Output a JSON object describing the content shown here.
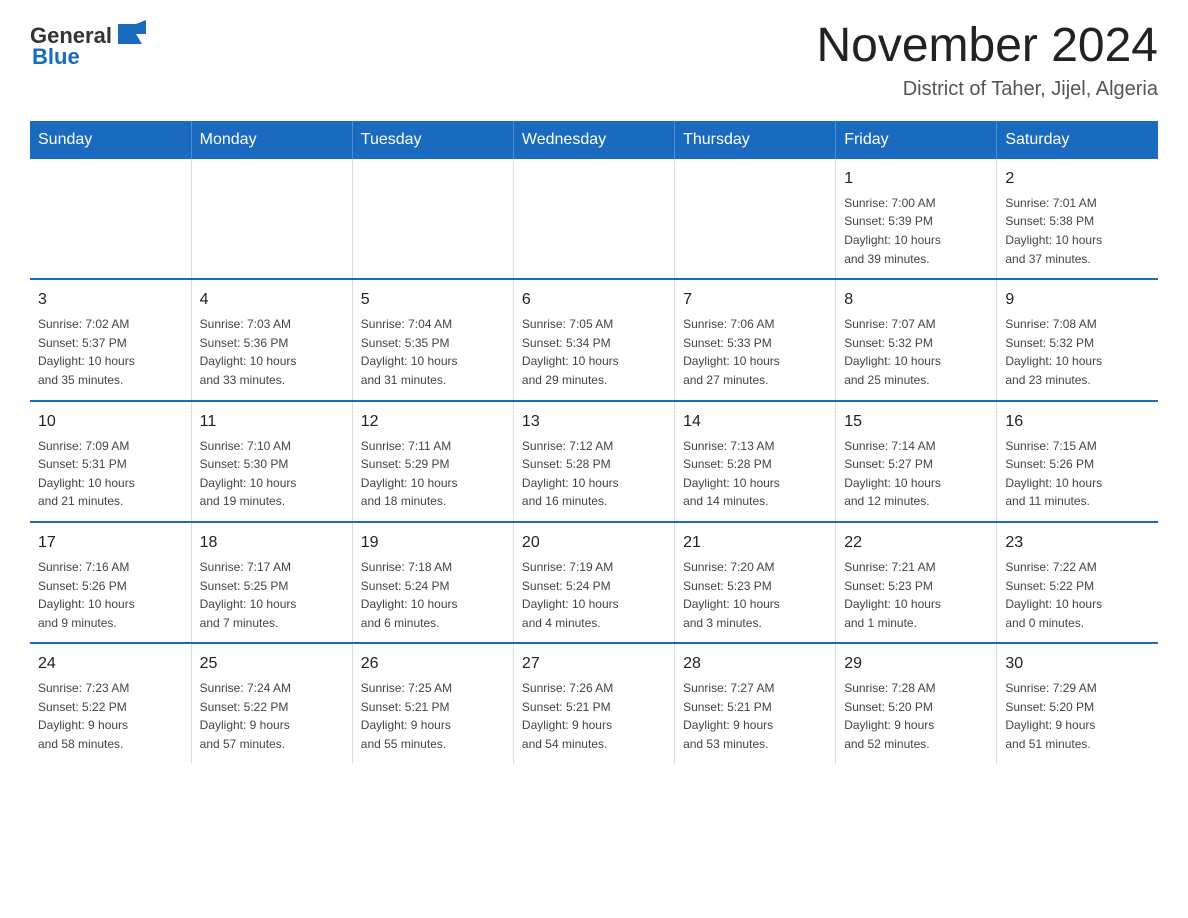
{
  "header": {
    "logo_general": "General",
    "logo_blue": "Blue",
    "month_title": "November 2024",
    "location": "District of Taher, Jijel, Algeria"
  },
  "weekdays": [
    "Sunday",
    "Monday",
    "Tuesday",
    "Wednesday",
    "Thursday",
    "Friday",
    "Saturday"
  ],
  "weeks": [
    [
      {
        "day": "",
        "info": ""
      },
      {
        "day": "",
        "info": ""
      },
      {
        "day": "",
        "info": ""
      },
      {
        "day": "",
        "info": ""
      },
      {
        "day": "",
        "info": ""
      },
      {
        "day": "1",
        "info": "Sunrise: 7:00 AM\nSunset: 5:39 PM\nDaylight: 10 hours\nand 39 minutes."
      },
      {
        "day": "2",
        "info": "Sunrise: 7:01 AM\nSunset: 5:38 PM\nDaylight: 10 hours\nand 37 minutes."
      }
    ],
    [
      {
        "day": "3",
        "info": "Sunrise: 7:02 AM\nSunset: 5:37 PM\nDaylight: 10 hours\nand 35 minutes."
      },
      {
        "day": "4",
        "info": "Sunrise: 7:03 AM\nSunset: 5:36 PM\nDaylight: 10 hours\nand 33 minutes."
      },
      {
        "day": "5",
        "info": "Sunrise: 7:04 AM\nSunset: 5:35 PM\nDaylight: 10 hours\nand 31 minutes."
      },
      {
        "day": "6",
        "info": "Sunrise: 7:05 AM\nSunset: 5:34 PM\nDaylight: 10 hours\nand 29 minutes."
      },
      {
        "day": "7",
        "info": "Sunrise: 7:06 AM\nSunset: 5:33 PM\nDaylight: 10 hours\nand 27 minutes."
      },
      {
        "day": "8",
        "info": "Sunrise: 7:07 AM\nSunset: 5:32 PM\nDaylight: 10 hours\nand 25 minutes."
      },
      {
        "day": "9",
        "info": "Sunrise: 7:08 AM\nSunset: 5:32 PM\nDaylight: 10 hours\nand 23 minutes."
      }
    ],
    [
      {
        "day": "10",
        "info": "Sunrise: 7:09 AM\nSunset: 5:31 PM\nDaylight: 10 hours\nand 21 minutes."
      },
      {
        "day": "11",
        "info": "Sunrise: 7:10 AM\nSunset: 5:30 PM\nDaylight: 10 hours\nand 19 minutes."
      },
      {
        "day": "12",
        "info": "Sunrise: 7:11 AM\nSunset: 5:29 PM\nDaylight: 10 hours\nand 18 minutes."
      },
      {
        "day": "13",
        "info": "Sunrise: 7:12 AM\nSunset: 5:28 PM\nDaylight: 10 hours\nand 16 minutes."
      },
      {
        "day": "14",
        "info": "Sunrise: 7:13 AM\nSunset: 5:28 PM\nDaylight: 10 hours\nand 14 minutes."
      },
      {
        "day": "15",
        "info": "Sunrise: 7:14 AM\nSunset: 5:27 PM\nDaylight: 10 hours\nand 12 minutes."
      },
      {
        "day": "16",
        "info": "Sunrise: 7:15 AM\nSunset: 5:26 PM\nDaylight: 10 hours\nand 11 minutes."
      }
    ],
    [
      {
        "day": "17",
        "info": "Sunrise: 7:16 AM\nSunset: 5:26 PM\nDaylight: 10 hours\nand 9 minutes."
      },
      {
        "day": "18",
        "info": "Sunrise: 7:17 AM\nSunset: 5:25 PM\nDaylight: 10 hours\nand 7 minutes."
      },
      {
        "day": "19",
        "info": "Sunrise: 7:18 AM\nSunset: 5:24 PM\nDaylight: 10 hours\nand 6 minutes."
      },
      {
        "day": "20",
        "info": "Sunrise: 7:19 AM\nSunset: 5:24 PM\nDaylight: 10 hours\nand 4 minutes."
      },
      {
        "day": "21",
        "info": "Sunrise: 7:20 AM\nSunset: 5:23 PM\nDaylight: 10 hours\nand 3 minutes."
      },
      {
        "day": "22",
        "info": "Sunrise: 7:21 AM\nSunset: 5:23 PM\nDaylight: 10 hours\nand 1 minute."
      },
      {
        "day": "23",
        "info": "Sunrise: 7:22 AM\nSunset: 5:22 PM\nDaylight: 10 hours\nand 0 minutes."
      }
    ],
    [
      {
        "day": "24",
        "info": "Sunrise: 7:23 AM\nSunset: 5:22 PM\nDaylight: 9 hours\nand 58 minutes."
      },
      {
        "day": "25",
        "info": "Sunrise: 7:24 AM\nSunset: 5:22 PM\nDaylight: 9 hours\nand 57 minutes."
      },
      {
        "day": "26",
        "info": "Sunrise: 7:25 AM\nSunset: 5:21 PM\nDaylight: 9 hours\nand 55 minutes."
      },
      {
        "day": "27",
        "info": "Sunrise: 7:26 AM\nSunset: 5:21 PM\nDaylight: 9 hours\nand 54 minutes."
      },
      {
        "day": "28",
        "info": "Sunrise: 7:27 AM\nSunset: 5:21 PM\nDaylight: 9 hours\nand 53 minutes."
      },
      {
        "day": "29",
        "info": "Sunrise: 7:28 AM\nSunset: 5:20 PM\nDaylight: 9 hours\nand 52 minutes."
      },
      {
        "day": "30",
        "info": "Sunrise: 7:29 AM\nSunset: 5:20 PM\nDaylight: 9 hours\nand 51 minutes."
      }
    ]
  ]
}
